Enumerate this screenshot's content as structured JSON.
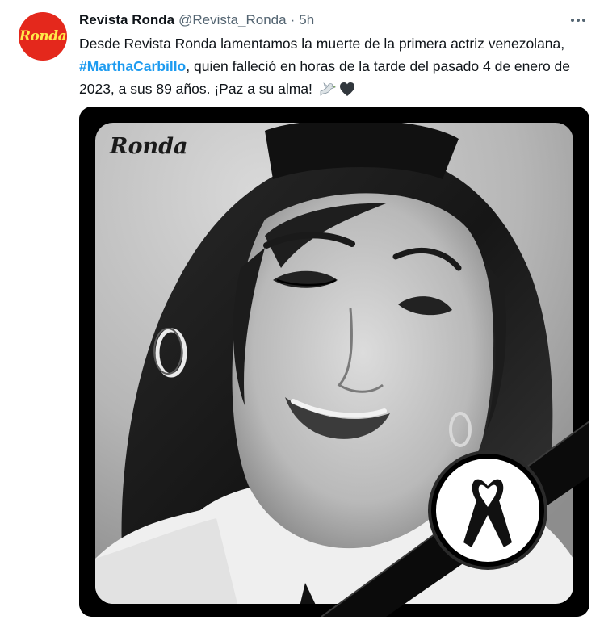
{
  "tweet": {
    "avatar": {
      "logo_text": "Ronda",
      "color": "#e4281c",
      "text_color": "#ffe94a"
    },
    "author": {
      "display_name": "Revista Ronda",
      "handle": "@Revista_Ronda",
      "separator": "·",
      "time": "5h"
    },
    "text": {
      "part1": "Desde Revista Ronda lamentamos la muerte de la primera actriz venezolana, ",
      "hashtag": "#MarthaCarbillo",
      "part2": ", quien falleció en horas de la tarde del pasado 4 de enero de 2023, a sus 89 años. ¡Paz a su alma!",
      "emojis": [
        "dove-emoji",
        "black-heart-emoji"
      ]
    },
    "media": {
      "watermark": "Ronda",
      "frame_color": "#000000",
      "description_icons": [
        "mourning-ribbon-icon"
      ]
    },
    "colors": {
      "link": "#1d9bf0",
      "secondary": "#536471",
      "text": "#0f1419"
    }
  }
}
